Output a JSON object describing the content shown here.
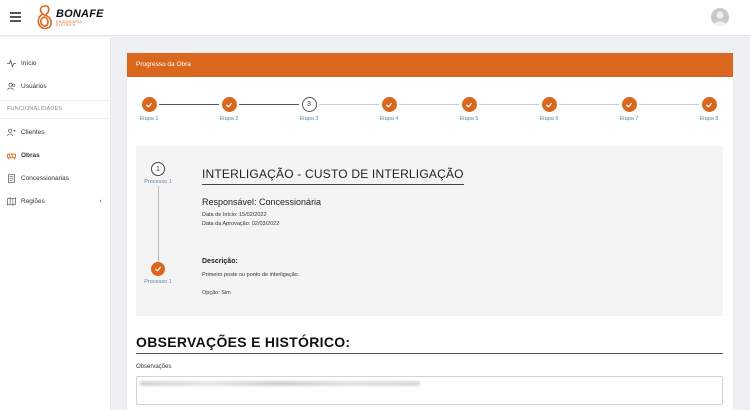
{
  "brand": {
    "name": "BONAFE",
    "tagline_1": "ENGENHARIA",
    "tagline_2": "ELÉTRICA",
    "accent": "#d9671d"
  },
  "sidebar": {
    "items_top": [
      {
        "label": "Início",
        "icon": "activity-icon"
      },
      {
        "label": "Usuários",
        "icon": "users-icon"
      }
    ],
    "section_label": "FUNCIONALIDADES",
    "items": [
      {
        "label": "Clientes",
        "icon": "clients-icon"
      },
      {
        "label": "Obras",
        "icon": "construction-icon",
        "active": true
      },
      {
        "label": "Concessionarias",
        "icon": "document-icon"
      },
      {
        "label": "Regiões",
        "icon": "map-icon",
        "chevron": "‹"
      }
    ]
  },
  "card": {
    "title": "Progresso da Obra"
  },
  "stepper": {
    "steps": [
      {
        "label": "Etapa 1",
        "state": "done"
      },
      {
        "label": "Etapa 2",
        "state": "done"
      },
      {
        "label": "Etapa 3",
        "state": "current",
        "number": "3"
      },
      {
        "label": "Etapa 4",
        "state": "done"
      },
      {
        "label": "Etapa 5",
        "state": "done"
      },
      {
        "label": "Etapa 6",
        "state": "done"
      },
      {
        "label": "Etapa 7",
        "state": "done"
      },
      {
        "label": "Etapa 8",
        "state": "done"
      }
    ]
  },
  "process": {
    "steps": [
      {
        "number": "1",
        "label": "Processo 1",
        "state": "current"
      },
      {
        "label": "Processo 1",
        "state": "done"
      }
    ],
    "title": "INTERLIGAÇÃO - CUSTO DE INTERLIGAÇÃO",
    "responsavel": "Responsável: Concessionária",
    "data_inicio": "Data de Início: 15/02/2022",
    "data_aprovacao": "Data da Aprovação: 02/03/2022",
    "descricao_label": "Descrição:",
    "descricao_text": "Primeiro poste ou ponto de interligação.",
    "opcao": "Opção: Sim"
  },
  "observacoes": {
    "section_title": "OBSERVAÇÕES E HISTÓRICO:",
    "field_label": "Observações"
  }
}
